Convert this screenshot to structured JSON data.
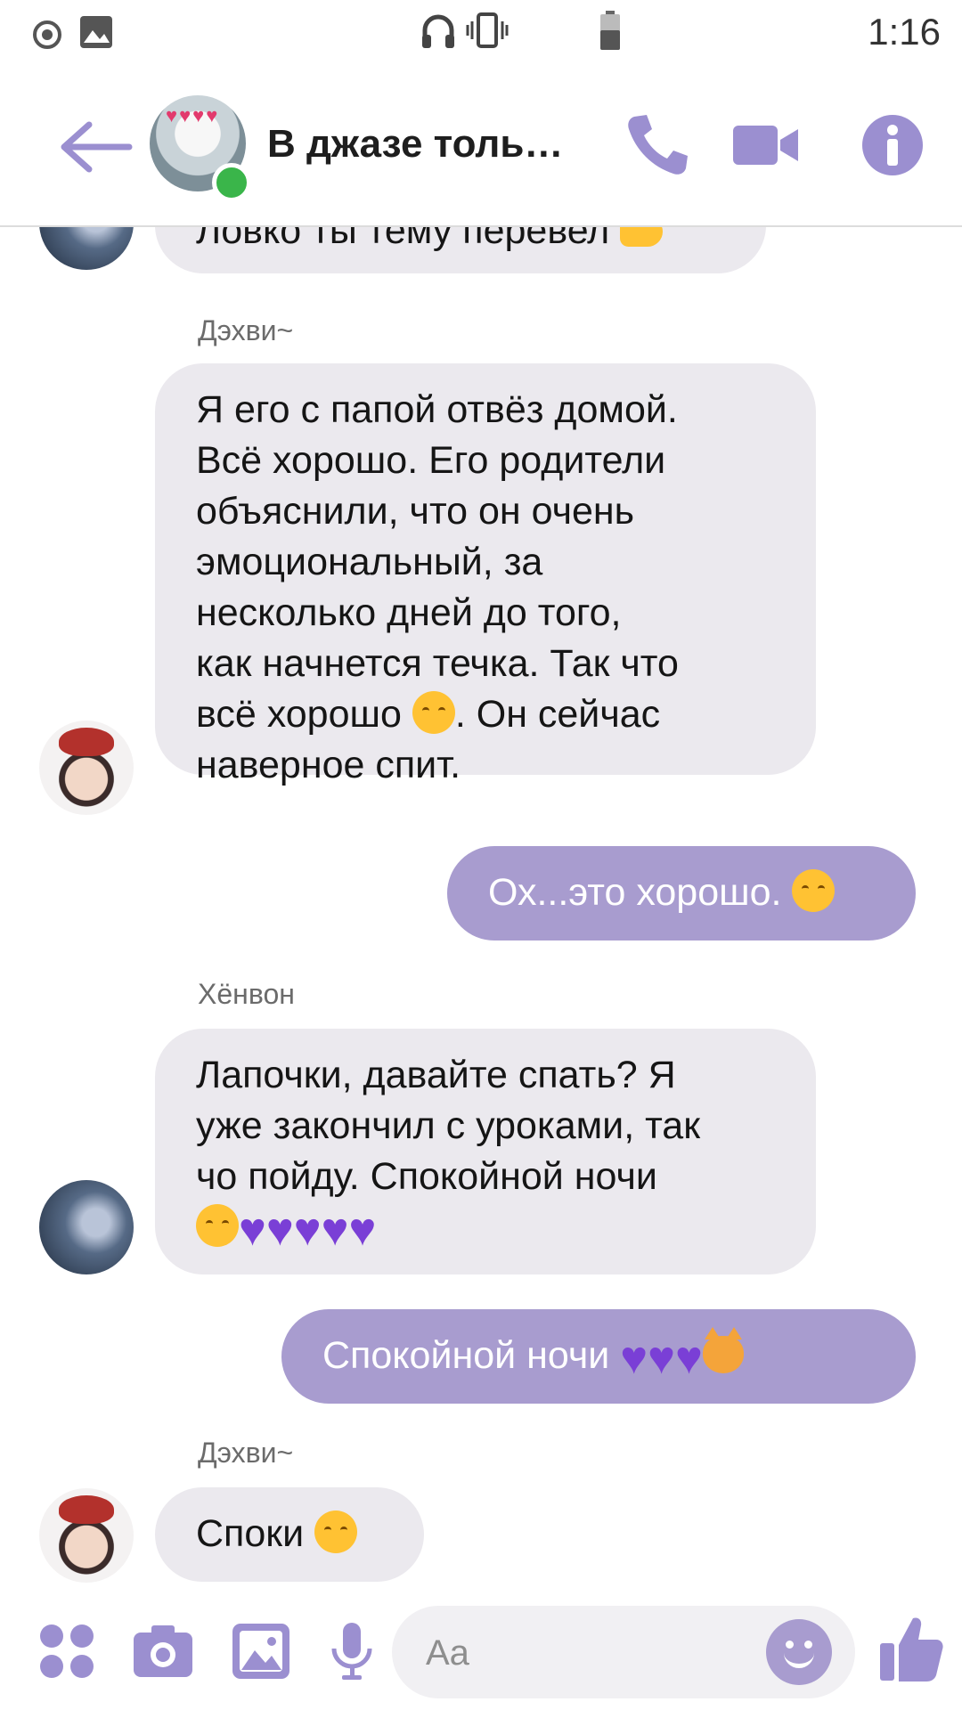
{
  "status_bar": {
    "time": "1:16"
  },
  "header": {
    "title": "В джазе толь…",
    "hearts": "♥♥♥♥"
  },
  "messages": [
    {
      "text": "Ловко ты тему перевел"
    },
    {
      "sender": "Дэхви~",
      "text_lines": [
        "Я его с папой отвёз домой.",
        "Всё хорошо. Его родители",
        "объяснили, что он очень",
        "эмоциональный, за",
        "несколько дней до того,",
        "как начнется течка. Так что",
        "всё хорошо",
        ". Он сейчас",
        "наверное спит."
      ]
    },
    {
      "text": "Ох...это хорошо."
    },
    {
      "sender": "Хёнвон",
      "text_lines": [
        "Лапочки, давайте спать? Я",
        "уже закончил с уроками, так",
        "чо пойду. Спокойной ночи"
      ]
    },
    {
      "text": "Спокойной ночи"
    },
    {
      "sender": "Дэхви~",
      "text": "Споки"
    }
  ],
  "composer": {
    "placeholder": "Aa"
  },
  "colors": {
    "accent": "#a89ccf",
    "incoming_bubble": "#ebe9ee",
    "heart": "#7a3fd6"
  }
}
